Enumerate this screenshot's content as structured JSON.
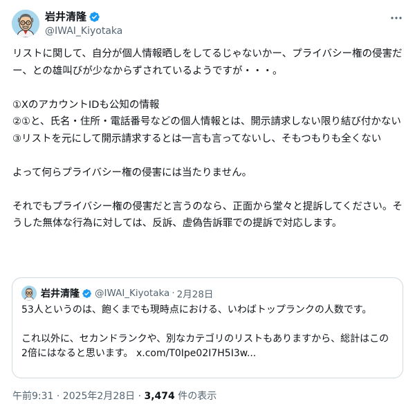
{
  "author": {
    "display_name": "岩井清隆",
    "handle": "@IWAI_Kiyotaka",
    "verified": true,
    "avatar_icon": "cartoon-man-with-glasses-avatar"
  },
  "more_icon": "more-dots-icon",
  "tweet": {
    "paragraphs": [
      "リストに関して、自分が個人情報晒しをしてるじゃないかー、プライバシー権の侵害だー、との雄叫びが少なからずされているようですが・・・。",
      "①XのアカウントIDも公知の情報\n②①と、氏名・住所・電話番号などの個人情報とは、開示請求しない限り結び付かない\n③リストを元にして開示請求するとは一言も言ってないし、そもつもりも全くない",
      "よって何らプライバシー権の侵害には当たりません。",
      "それでもプライバシー権の侵害だと言うのなら、正面から堂々と提訴してください。そうした無体な行為に対しては、反訴、虚偽告訴罪での提訴で対応します。"
    ]
  },
  "quote": {
    "display_name": "岩井清隆",
    "handle": "@IWAI_Kiyotaka",
    "separator": "·",
    "date": "2月28日",
    "paragraphs": [
      "53人というのは、飽くまでも現時点における、いわばトップランクの人数です。",
      "これ以外に、セカンドランクや、別なカテゴリのリストもありますから、総計はこの2倍にはなると思います。"
    ],
    "link_text": "x.com/T0Ipe02I7H5I3w..."
  },
  "meta": {
    "timestamp": "午前9:31 · 2025年2月28日 · ",
    "views_count": "3,474",
    "views_label": " 件の表示"
  },
  "colors": {
    "verified_blue": "#1d9bf0",
    "secondary_text": "#536471",
    "border": "#cfd9de"
  }
}
